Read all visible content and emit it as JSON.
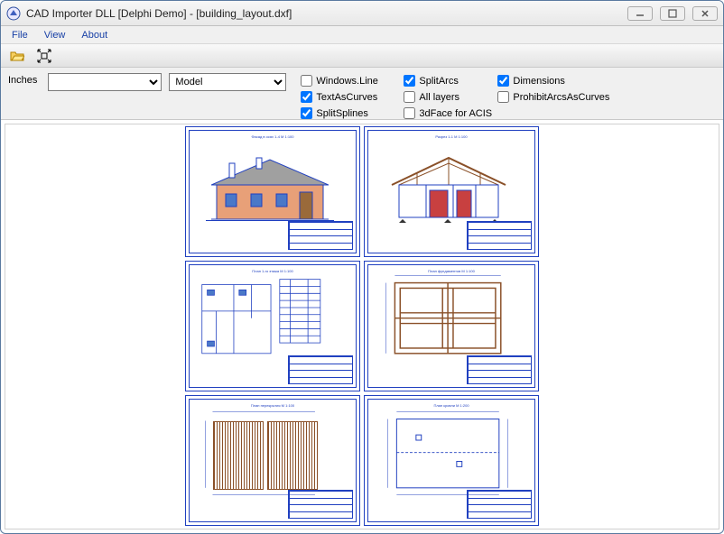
{
  "window": {
    "title": "CAD Importer DLL [Delphi Demo] - [building_layout.dxf]"
  },
  "menu": {
    "file": "File",
    "view": "View",
    "about": "About"
  },
  "options": {
    "units_label": "Inches",
    "units_value": "",
    "model_value": "Model",
    "chk": {
      "windows_line": "Windows.Line",
      "text_as_curves": "TextAsCurves",
      "split_splines": "SplitSplines",
      "split_arcs": "SplitArcs",
      "all_layers": "All layers",
      "face_acis": "3dFace for ACIS",
      "dimensions": "Dimensions",
      "prohibit_arcs": "ProhibitArcsAsCurves"
    }
  }
}
